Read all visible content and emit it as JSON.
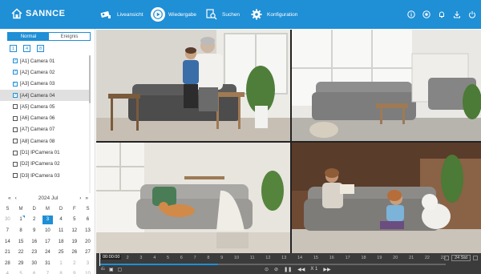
{
  "brand": {
    "name": "SANNCE",
    "accent": "#1f8fd6"
  },
  "nav": {
    "items": [
      {
        "label": "Liveansicht",
        "icon": "camera-icon"
      },
      {
        "label": "Wiedergabe",
        "icon": "playback-icon"
      },
      {
        "label": "Suchen",
        "icon": "search-icon"
      },
      {
        "label": "Konfiguration",
        "icon": "gear-icon"
      }
    ],
    "active": "Wiedergabe"
  },
  "top_icons": [
    "info-icon",
    "record-icon",
    "bell-icon",
    "download-icon",
    "power-icon"
  ],
  "sidebar": {
    "tabs": [
      {
        "label": "Normal"
      },
      {
        "label": "Ereignis"
      }
    ],
    "split_options": [
      "1",
      "4",
      "8"
    ],
    "cameras": [
      {
        "label": "[A1] Camera 01",
        "checked": true
      },
      {
        "label": "[A2] Camera 02",
        "checked": true
      },
      {
        "label": "[A3] Camera 03",
        "checked": true
      },
      {
        "label": "[A4] Camera 04",
        "checked": true
      },
      {
        "label": "[A5] Camera 05",
        "checked": false
      },
      {
        "label": "[A6] Camera 06",
        "checked": false
      },
      {
        "label": "[A7] Camera 07",
        "checked": false
      },
      {
        "label": "[A8] Camera 08",
        "checked": false
      },
      {
        "label": "[D1] IPCamera 01",
        "checked": false
      },
      {
        "label": "[D2] IPCamera 02",
        "checked": false
      },
      {
        "label": "[D3] IPCamera 03",
        "checked": false
      }
    ],
    "selected_camera": "[A4] Camera 04"
  },
  "calendar": {
    "year_prev": "«",
    "month_prev": "‹",
    "month_next": "›",
    "year_next": "»",
    "year": "2024",
    "month": "Jul",
    "weekdays": [
      "S",
      "M",
      "D",
      "M",
      "D",
      "F",
      "S"
    ],
    "weeks": [
      [
        {
          "d": "30",
          "m": true
        },
        {
          "d": "1",
          "mark": true
        },
        {
          "d": "2"
        },
        {
          "d": "3",
          "sel": true
        },
        {
          "d": "4"
        },
        {
          "d": "5"
        },
        {
          "d": "6"
        }
      ],
      [
        {
          "d": "7"
        },
        {
          "d": "8"
        },
        {
          "d": "9"
        },
        {
          "d": "10"
        },
        {
          "d": "11"
        },
        {
          "d": "12"
        },
        {
          "d": "13"
        }
      ],
      [
        {
          "d": "14"
        },
        {
          "d": "15"
        },
        {
          "d": "16"
        },
        {
          "d": "17"
        },
        {
          "d": "18"
        },
        {
          "d": "19"
        },
        {
          "d": "20"
        }
      ],
      [
        {
          "d": "21"
        },
        {
          "d": "22"
        },
        {
          "d": "23"
        },
        {
          "d": "24"
        },
        {
          "d": "25"
        },
        {
          "d": "26"
        },
        {
          "d": "27"
        }
      ],
      [
        {
          "d": "28"
        },
        {
          "d": "29"
        },
        {
          "d": "30"
        },
        {
          "d": "31"
        },
        {
          "d": "1",
          "m": true
        },
        {
          "d": "2",
          "m": true
        },
        {
          "d": "3",
          "m": true
        }
      ],
      [
        {
          "d": "4",
          "m": true
        },
        {
          "d": "5",
          "m": true
        },
        {
          "d": "6",
          "m": true
        },
        {
          "d": "7",
          "m": true
        },
        {
          "d": "8",
          "m": true
        },
        {
          "d": "9",
          "m": true
        },
        {
          "d": "10",
          "m": true
        }
      ]
    ]
  },
  "timeline": {
    "time": "00:00:00",
    "hours": [
      "0",
      "1",
      "2",
      "3",
      "4",
      "5",
      "6",
      "7",
      "8",
      "9",
      "10",
      "11",
      "12",
      "13",
      "14",
      "15",
      "16",
      "17",
      "18",
      "19",
      "20",
      "21",
      "22",
      "23"
    ],
    "recorded_until_hour": 8.2,
    "zoom_label": "24 Std",
    "speed_label": "X 1"
  }
}
